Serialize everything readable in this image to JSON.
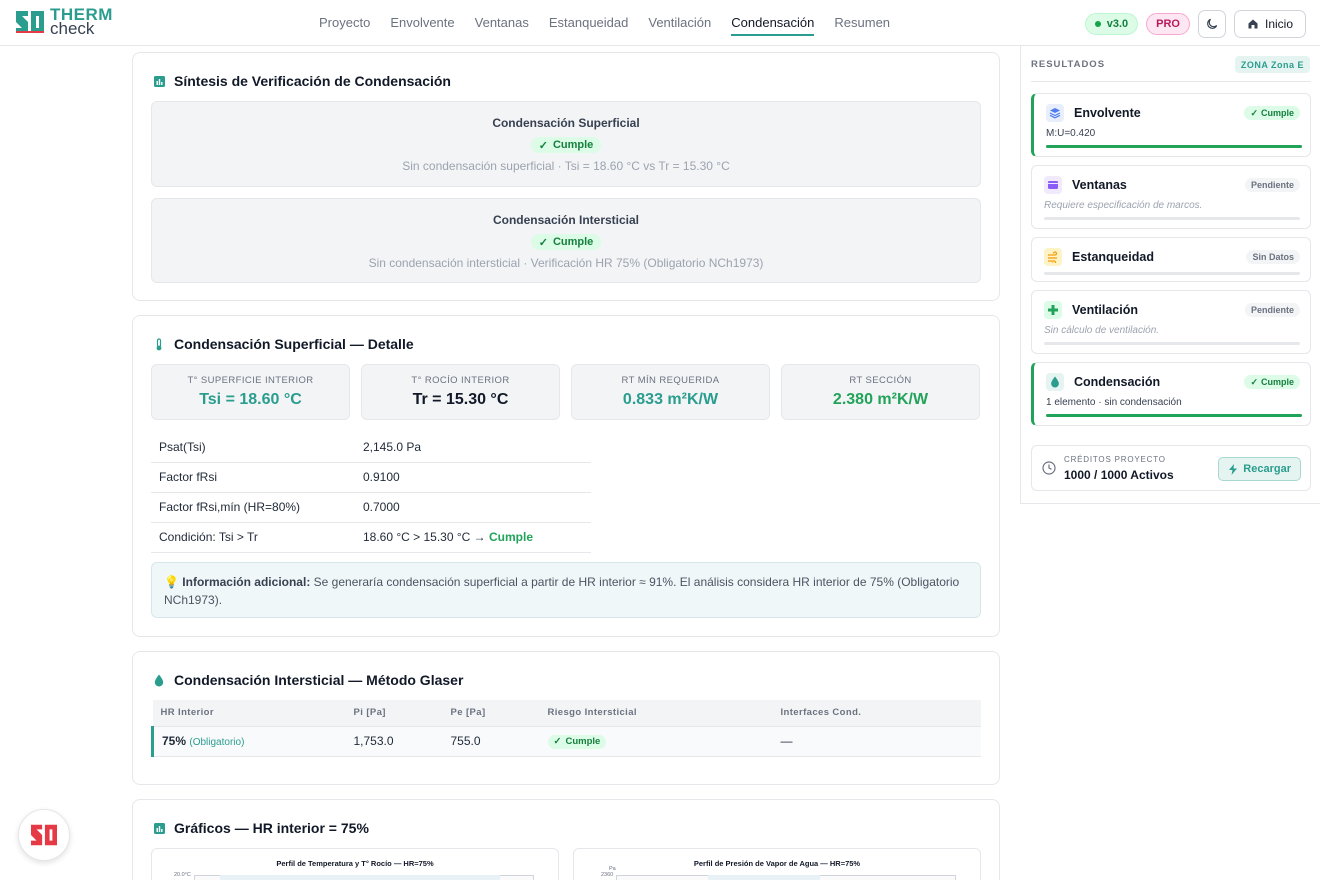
{
  "brand": {
    "line1": "THERM",
    "line2": "check"
  },
  "nav": {
    "items": [
      "Proyecto",
      "Envolvente",
      "Ventanas",
      "Estanqueidad",
      "Ventilación",
      "Condensación",
      "Resumen"
    ],
    "active": "Condensación"
  },
  "header": {
    "version": "v3.0",
    "plan": "PRO",
    "home_label": "Inicio"
  },
  "synthesis": {
    "title": "Síntesis de Verificación de Condensación",
    "superficial": {
      "heading": "Condensación Superficial",
      "status": "Cumple",
      "detail": "Sin condensación superficial · Tsi = 18.60 °C vs Tr = 15.30 °C"
    },
    "intersticial": {
      "heading": "Condensación Intersticial",
      "status": "Cumple",
      "detail": "Sin condensación intersticial · Verificación HR 75% (Obligatorio NCh1973)"
    }
  },
  "superficial_detail": {
    "title": "Condensación Superficial — Detalle",
    "metrics": [
      {
        "label": "T° Superficie Interior",
        "value": "Tsi = 18.60 °C",
        "color": "#2a9d8f"
      },
      {
        "label": "T° Rocío Interior",
        "value": "Tr = 15.30 °C",
        "color": "#111827"
      },
      {
        "label": "RT Mín Requerida",
        "value": "0.833 m²K/W",
        "color": "#2a9d8f"
      },
      {
        "label": "RT Sección",
        "value": "2.380 m²K/W",
        "color": "#22a35a"
      }
    ],
    "rows": [
      {
        "key": "Psat(Tsi)",
        "value": "2,145.0 Pa"
      },
      {
        "key": "Factor fRsi",
        "value": "0.9100"
      },
      {
        "key": "Factor fRsi,mín (HR=80%)",
        "value": "0.7000"
      },
      {
        "key": "Condición: Tsi > Tr",
        "value": "18.60 °C > 15.30 °C →",
        "status": "Cumple"
      }
    ],
    "info_label": "Información adicional:",
    "info_text": "Se generaría condensación superficial a partir de HR interior ≈ 91%. El análisis considera HR interior de 75% (Obligatorio NCh1973)."
  },
  "glaser": {
    "title": "Condensación Intersticial — Método Glaser",
    "headers": [
      "HR Interior",
      "Pi [Pa]",
      "Pe [Pa]",
      "Riesgo Intersticial",
      "Interfaces Cond."
    ],
    "row": {
      "hr": "75%",
      "tag": "(Obligatorio)",
      "pi": "1,753.0",
      "pe": "755.0",
      "risk": "Cumple",
      "interfaces": "—"
    }
  },
  "charts": {
    "title": "Gráficos — HR interior = 75%",
    "left": {
      "title": "Perfil de Temperatura y T° Rocío — HR=75%",
      "tick": "20.0°C"
    },
    "right": {
      "title": "Perfil de Presión de Vapor de Agua — HR=75%",
      "unit": "Pa",
      "tick": "2360"
    }
  },
  "sidebar": {
    "heading": "Resultados",
    "zone": "ZONA Zona E",
    "modules": [
      {
        "name": "Envolvente",
        "status": "Cumple",
        "state": "pass",
        "sub": "M:U=0.420",
        "progress": 1.0,
        "icon": "layers-icon",
        "icon_color": "#4f7cf0"
      },
      {
        "name": "Ventanas",
        "status": "Pendiente",
        "state": "pend",
        "sub": "Requiere especificación de marcos.",
        "progress": 0,
        "icon": "window-icon",
        "icon_color": "#8b5cf6"
      },
      {
        "name": "Estanqueidad",
        "status": "Sin Datos",
        "state": "pend",
        "sub": "",
        "progress": 0,
        "icon": "wind-icon",
        "icon_color": "#f59e0b"
      },
      {
        "name": "Ventilación",
        "status": "Pendiente",
        "state": "pend",
        "sub": "Sin cálculo de ventilación.",
        "progress": 0,
        "icon": "ventilation-icon",
        "icon_color": "#22a35a"
      },
      {
        "name": "Condensación",
        "status": "Cumple",
        "state": "pass",
        "sub": "1 elemento · sin condensación",
        "progress": 1.0,
        "icon": "droplet-icon",
        "icon_color": "#2a9d8f"
      }
    ],
    "credits": {
      "label": "Créditos Proyecto",
      "value": "1000 / 1000 Activos",
      "action": "Recargar"
    }
  }
}
